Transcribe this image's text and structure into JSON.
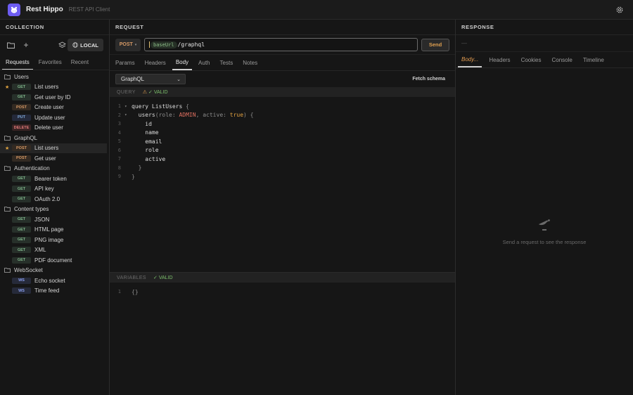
{
  "app": {
    "title": "Rest Hippo",
    "subtitle": "REST API Client"
  },
  "collection": {
    "heading": "COLLECTION",
    "env_button": "LOCAL",
    "tabs": [
      "Requests",
      "Favorites",
      "Recent"
    ],
    "folders": [
      {
        "name": "Users",
        "requests": [
          {
            "method": "GET",
            "name": "List users",
            "starred": true,
            "selected": false
          },
          {
            "method": "GET",
            "name": "Get user by ID",
            "starred": false,
            "selected": false
          },
          {
            "method": "POST",
            "name": "Create user",
            "starred": false,
            "selected": false
          },
          {
            "method": "PUT",
            "name": "Update user",
            "starred": false,
            "selected": false
          },
          {
            "method": "DELETE",
            "name": "Delete user",
            "starred": false,
            "selected": false
          }
        ]
      },
      {
        "name": "GraphQL",
        "requests": [
          {
            "method": "POST",
            "name": "List users",
            "starred": true,
            "selected": true
          },
          {
            "method": "POST",
            "name": "Get user",
            "starred": false,
            "selected": false
          }
        ]
      },
      {
        "name": "Authentication",
        "requests": [
          {
            "method": "GET",
            "name": "Bearer token",
            "starred": false,
            "selected": false
          },
          {
            "method": "GET",
            "name": "API key",
            "starred": false,
            "selected": false
          },
          {
            "method": "GET",
            "name": "OAuth 2.0",
            "starred": false,
            "selected": false
          }
        ]
      },
      {
        "name": "Content types",
        "requests": [
          {
            "method": "GET",
            "name": "JSON",
            "starred": false,
            "selected": false
          },
          {
            "method": "GET",
            "name": "HTML page",
            "starred": false,
            "selected": false
          },
          {
            "method": "GET",
            "name": "PNG image",
            "starred": false,
            "selected": false
          },
          {
            "method": "GET",
            "name": "XML",
            "starred": false,
            "selected": false
          },
          {
            "method": "GET",
            "name": "PDF document",
            "starred": false,
            "selected": false
          }
        ]
      },
      {
        "name": "WebSocket",
        "requests": [
          {
            "method": "WS",
            "name": "Echo socket",
            "starred": false,
            "selected": false
          },
          {
            "method": "WS",
            "name": "Time feed",
            "starred": false,
            "selected": false
          }
        ]
      }
    ]
  },
  "request": {
    "heading": "REQUEST",
    "method": "POST",
    "url_var": "baseUrl",
    "url_path": "/graphql",
    "send_label": "Send",
    "tabs": [
      "Params",
      "Headers",
      "Body",
      "Auth",
      "Tests",
      "Notes"
    ],
    "active_tab": "Body",
    "body_type": "GraphQL",
    "fetch_schema": "Fetch schema",
    "query_label": "QUERY",
    "query_status": "VALID",
    "query_lines": [
      {
        "n": "1",
        "fold": true
      },
      {
        "n": "2",
        "fold": true
      },
      {
        "n": "3",
        "text": "id"
      },
      {
        "n": "4",
        "text": "name"
      },
      {
        "n": "5",
        "text": "email"
      },
      {
        "n": "6",
        "text": "role"
      },
      {
        "n": "7",
        "text": "active"
      },
      {
        "n": "8",
        "text": "}"
      },
      {
        "n": "9",
        "text": "}"
      }
    ],
    "query_line1": {
      "kw": "query",
      "name": "ListUsers",
      "brace": "{"
    },
    "query_line2": {
      "field": "users",
      "arg1": "role:",
      "val1": "ADMIN",
      "arg2": "active:",
      "val2": "true",
      "close": ") {"
    },
    "variables_label": "VARIABLES",
    "variables_status": "VALID",
    "variables_line": {
      "n": "1",
      "text": "{}"
    }
  },
  "response": {
    "heading": "RESPONSE",
    "url_placeholder": "—",
    "tabs": [
      "Body...",
      "Headers",
      "Cookies",
      "Console",
      "Timeline"
    ],
    "active_tab": "Body...",
    "empty_text": "Send a request to see the response"
  }
}
